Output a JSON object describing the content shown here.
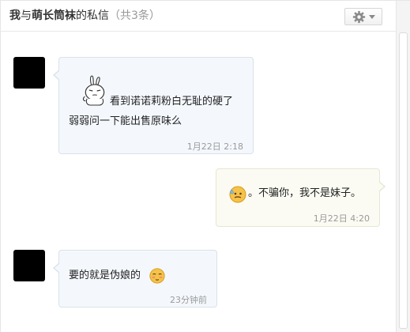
{
  "header": {
    "title_self": "我",
    "title_sep": "与",
    "title_user": "萌长筒袜",
    "title_suffix": "的私信",
    "count": "（共3条）",
    "settings_icon": "gear-icon",
    "dropdown_icon": "caret-down-icon"
  },
  "messages": [
    {
      "direction": "incoming",
      "line1": "看到诺诺莉粉白无耻的硬了",
      "line2": "弱弱问一下能出售原味么",
      "emoji": "rabbit-sticker-icon",
      "time": "1月22日 2:18"
    },
    {
      "direction": "outgoing",
      "text": "。不骗你，我不是妹子。",
      "emoji": "sweat-face-icon",
      "time": "1月22日 4:20"
    },
    {
      "direction": "incoming",
      "text": "要的就是伪娘的",
      "emoji": "shy-face-icon",
      "time": "23分钟前"
    }
  ],
  "colors": {
    "incoming_bubble": "#f4f8fd",
    "outgoing_bubble": "#fbfbf3",
    "emoji_yellow": "#f5c24a"
  }
}
